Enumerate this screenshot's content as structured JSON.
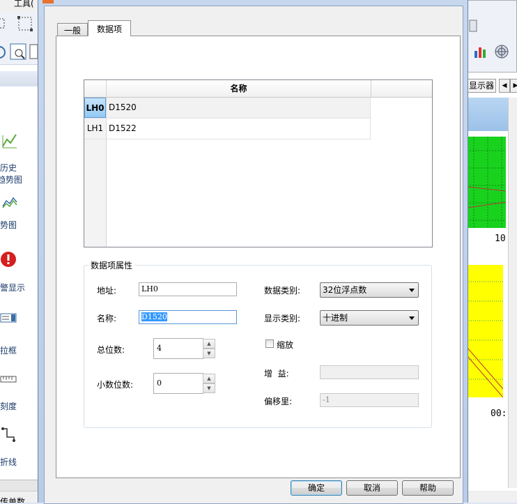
{
  "background_app": {
    "menu_tools": "工具(",
    "sidebar_items": [
      {
        "label": "历史",
        "icon": "history-trend-icon"
      },
      {
        "label": "趋势图",
        "icon": "history-trend-icon"
      },
      {
        "label": "势图",
        "icon": "trend-chart-icon"
      },
      {
        "label": "警显示",
        "icon": "alarm-display-icon"
      },
      {
        "label": "拉框",
        "icon": "dropdown-box-icon"
      },
      {
        "label": "刻度",
        "icon": "scale-ruler-icon"
      },
      {
        "label": "折线",
        "icon": "polyline-icon"
      }
    ],
    "status_text": "传单数",
    "display_tab": "显示器",
    "green_chart_axis": "10",
    "yellow_chart_axis": "00:",
    "colors": {
      "green_chart": "#19d21e",
      "yellow_chart": "#ffff00"
    }
  },
  "dialog": {
    "tabs": [
      {
        "label": "一般",
        "active": false
      },
      {
        "label": "数据项",
        "active": true
      }
    ],
    "grid": {
      "column_header": "名称",
      "rows": [
        {
          "id": "LH0",
          "name": "D1520",
          "selected": true
        },
        {
          "id": "LH1",
          "name": "D1522",
          "selected": false
        }
      ]
    },
    "properties": {
      "group_title": "数据项属性",
      "address_label": "地址:",
      "address_value": "LH0",
      "name_label": "名称:",
      "name_value": "D1520",
      "total_digits_label": "总位数:",
      "total_digits_value": "4",
      "decimal_digits_label": "小数位数:",
      "decimal_digits_value": "0",
      "data_type_label": "数据类别:",
      "data_type_value": "32位浮点数",
      "display_type_label": "显示类别:",
      "display_type_value": "十进制",
      "scale_label": "缩放",
      "scale_checked": false,
      "gain_label": "增  益:",
      "gain_value": "",
      "offset_label": "偏移里:",
      "offset_value": "-1"
    },
    "buttons": {
      "ok": "确定",
      "cancel": "取消",
      "help": "帮助"
    }
  }
}
